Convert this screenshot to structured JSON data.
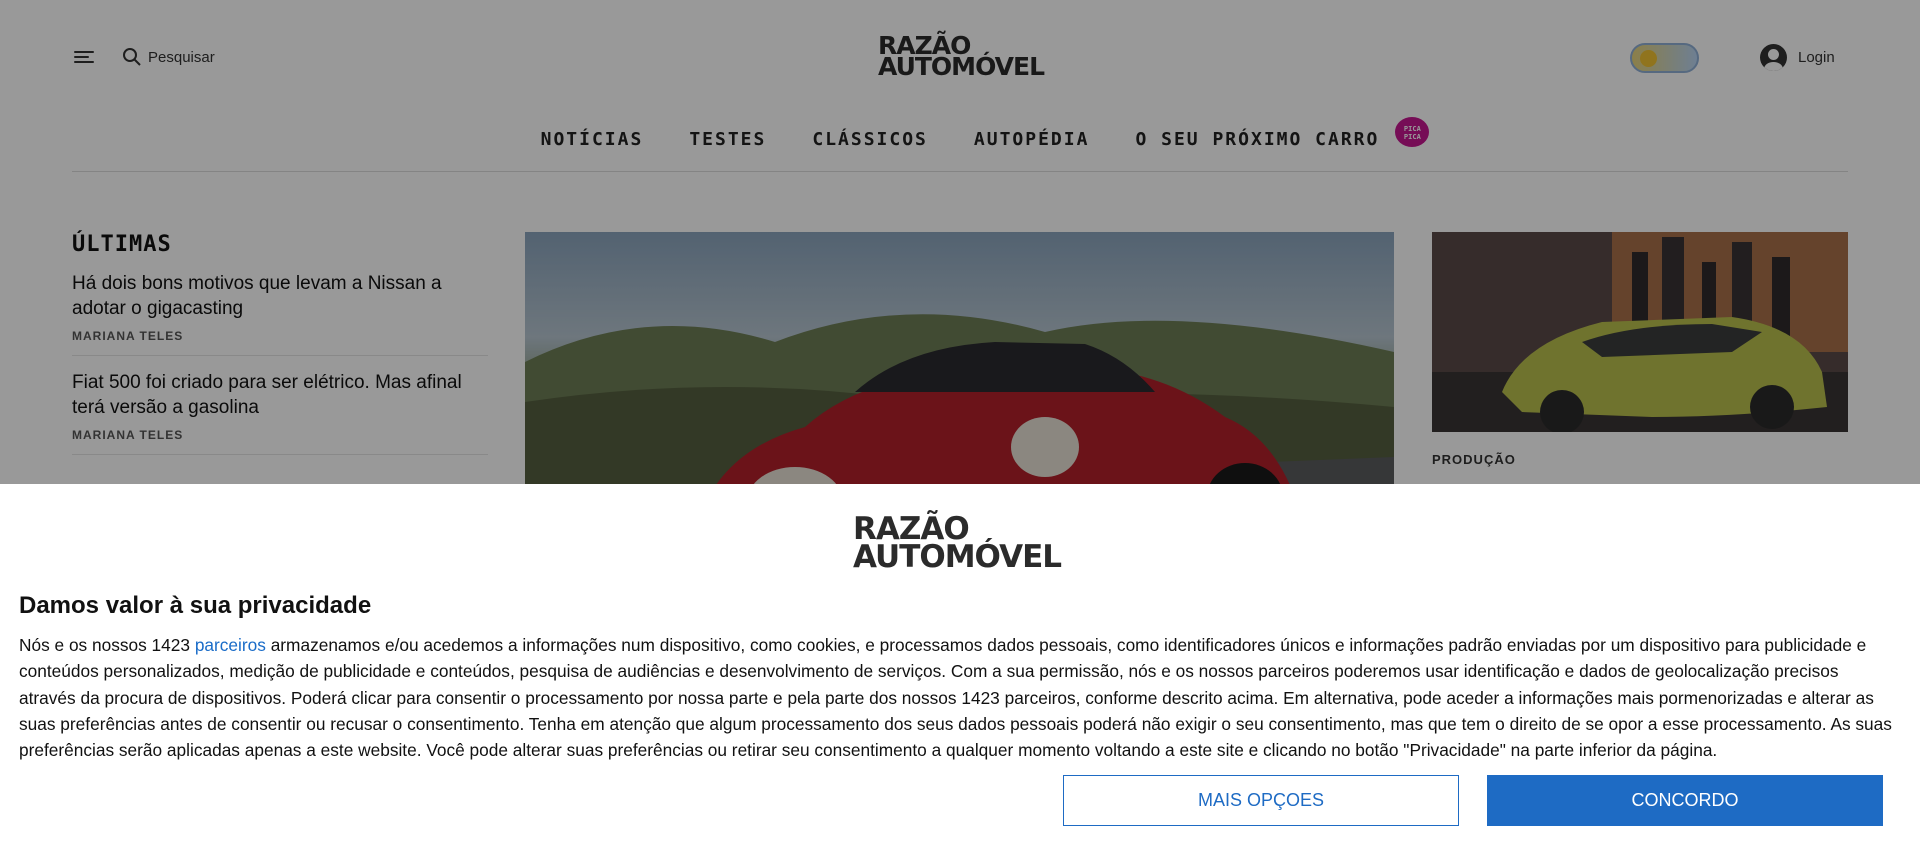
{
  "header": {
    "search_label": "Pesquisar",
    "logo_line1": "RAZÃO",
    "logo_line2": "AUTOMÓVEL",
    "login_label": "Login"
  },
  "nav": {
    "items": [
      "NOTÍCIAS",
      "TESTES",
      "CLÁSSICOS",
      "AUTOPÉDIA",
      "O SEU PRÓXIMO CARRO"
    ],
    "badge": "PICA PICA"
  },
  "ultimas": {
    "title": "ÚLTIMAS",
    "articles": [
      {
        "title": "Há dois bons motivos que levam a Nissan a adotar o gigacasting",
        "author": "MARIANA TELES"
      },
      {
        "title": "Fiat 500 foi criado para ser elétrico. Mas afinal terá versão a gasolina",
        "author": "MARIANA TELES"
      }
    ]
  },
  "side": {
    "category": "PRODUÇÃO"
  },
  "consent": {
    "logo_line1": "RAZÃO",
    "logo_line2": "AUTOMÓVEL",
    "title": "Damos valor à sua privacidade",
    "text_before_link": "Nós e os nossos 1423 ",
    "link": "parceiros",
    "text_after_link": " armazenamos e/ou acedemos a informações num dispositivo, como cookies, e processamos dados pessoais, como identificadores únicos e informações padrão enviadas por um dispositivo para publicidade e conteúdos personalizados, medição de publicidade e conteúdos, pesquisa de audiências e desenvolvimento de serviços. Com a sua permissão, nós e os nossos parceiros poderemos usar identificação e dados de geolocalização precisos através da procura de dispositivos. Poderá clicar para consentir o processamento por nossa parte e pela parte dos nossos 1423 parceiros, conforme descrito acima. Em alternativa, pode aceder a informações mais pormenorizadas e alterar as suas preferências antes de consentir ou recusar o consentimento. Tenha em atenção que algum processamento dos seus dados pessoais poderá não exigir o seu consentimento, mas que tem o direito de se opor a esse processamento. As suas preferências serão aplicadas apenas a este website. Você pode alterar suas preferências ou retirar seu consentimento a qualquer momento voltando a este site e clicando no botão \"Privacidade\" na parte inferior da página.",
    "more_options": "MAIS OPÇOES",
    "agree": "CONCORDO"
  },
  "colors": {
    "accent_blue": "#1e6bc4",
    "badge_magenta": "#c5168f",
    "overlay": "rgba(0,0,0,0.4)"
  },
  "icons": [
    "menu-icon",
    "search-icon",
    "theme-toggle",
    "user-icon"
  ]
}
